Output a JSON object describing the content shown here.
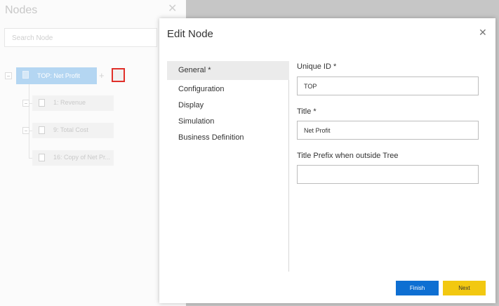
{
  "nodes_panel": {
    "title": "Nodes",
    "close_glyph": "✕",
    "search_placeholder": "Search Node",
    "add_glyph": "+",
    "tree": {
      "root": {
        "label": "TOP: Net Profit",
        "icon": "document-icon"
      },
      "children": [
        {
          "label": "1: Revenue",
          "icon": "document-icon"
        },
        {
          "label": "9: Total Cost",
          "icon": "document-icon"
        },
        {
          "label": "16: Copy of Net Pr...",
          "icon": "document-icon"
        }
      ]
    }
  },
  "dialog": {
    "title": "Edit Node",
    "close_glyph": "✕",
    "nav": [
      {
        "label": "General *",
        "active": true
      },
      {
        "label": "Configuration",
        "active": false
      },
      {
        "label": "Display",
        "active": false
      },
      {
        "label": "Simulation",
        "active": false
      },
      {
        "label": "Business Definition",
        "active": false
      }
    ],
    "fields": {
      "unique_id": {
        "label": "Unique ID *",
        "value": "TOP"
      },
      "title": {
        "label": "Title *",
        "value": "Net Profit"
      },
      "title_prefix": {
        "label": "Title Prefix when outside Tree",
        "value": ""
      }
    },
    "buttons": {
      "finish": "Finish",
      "next": "Next"
    }
  },
  "colors": {
    "finish_button": "#0e6fd2",
    "next_button": "#f2c811",
    "root_node": "#b4d6f2",
    "highlight_border": "#e0302a"
  }
}
